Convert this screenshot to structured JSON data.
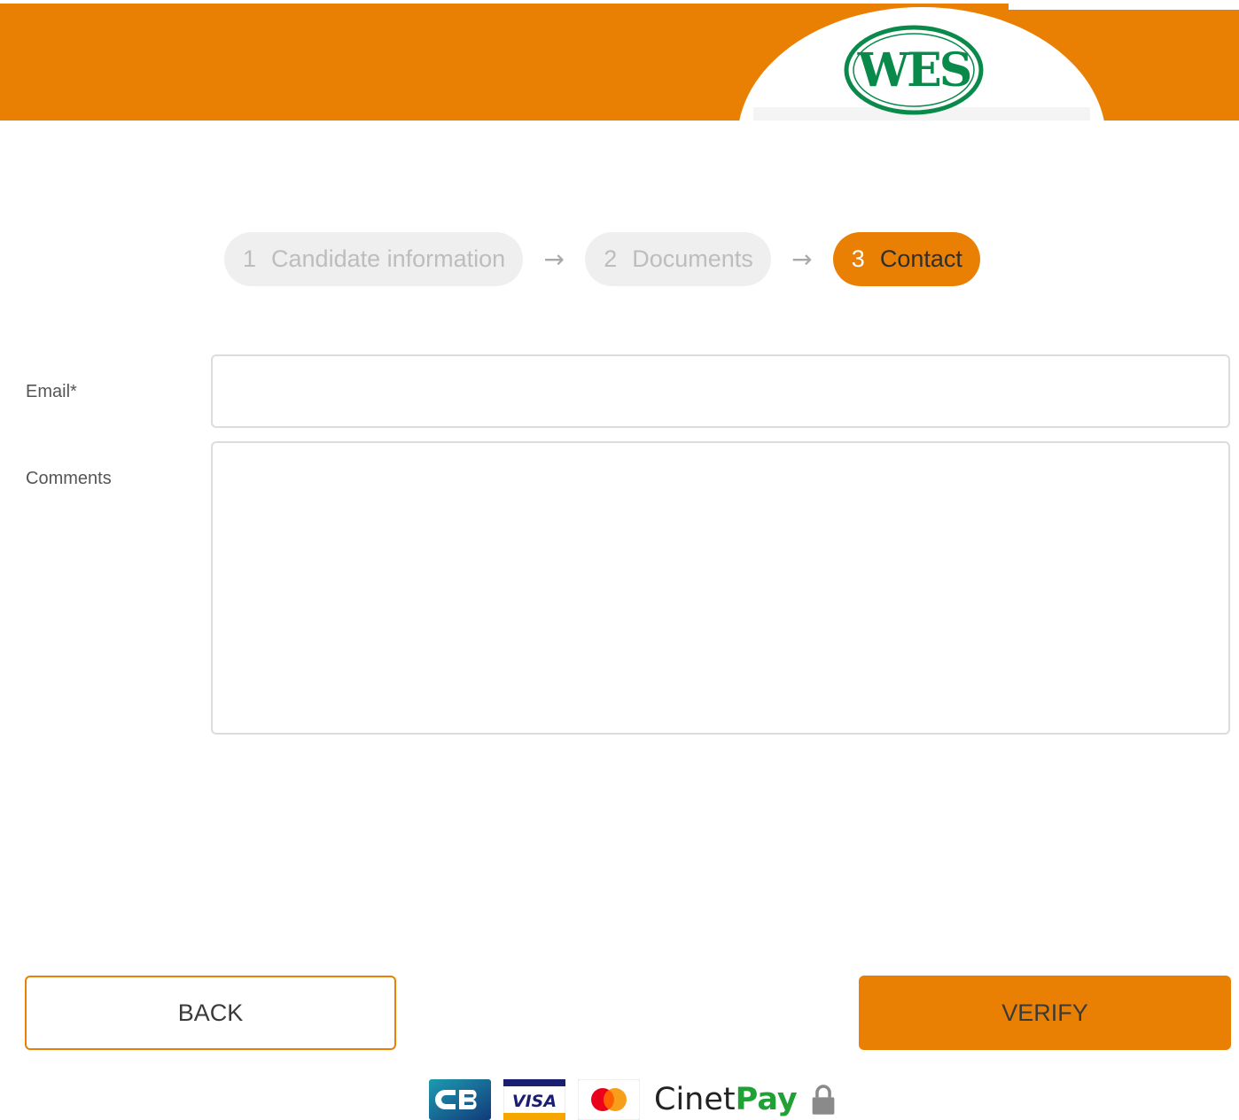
{
  "brand": {
    "logo_text": "WES",
    "primary_color": "#ea8003",
    "logo_color": "#0a8a4a"
  },
  "stepper": {
    "steps": [
      {
        "number": "1",
        "label": "Candidate information",
        "state": "inactive"
      },
      {
        "number": "2",
        "label": "Documents",
        "state": "inactive"
      },
      {
        "number": "3",
        "label": "Contact",
        "state": "active"
      }
    ],
    "separator_icon": "arrow-right-icon"
  },
  "form": {
    "email": {
      "label": "Email*",
      "value": "",
      "placeholder": ""
    },
    "comments": {
      "label": "Comments",
      "value": "",
      "placeholder": ""
    }
  },
  "actions": {
    "back_label": "BACK",
    "verify_label": "VERIFY"
  },
  "payments": {
    "logos": [
      "cb-icon",
      "visa-icon",
      "mastercard-icon"
    ],
    "cinetpay_prefix": "Cinet",
    "cinetpay_suffix": "Pay",
    "secure_icon": "lock-icon"
  }
}
